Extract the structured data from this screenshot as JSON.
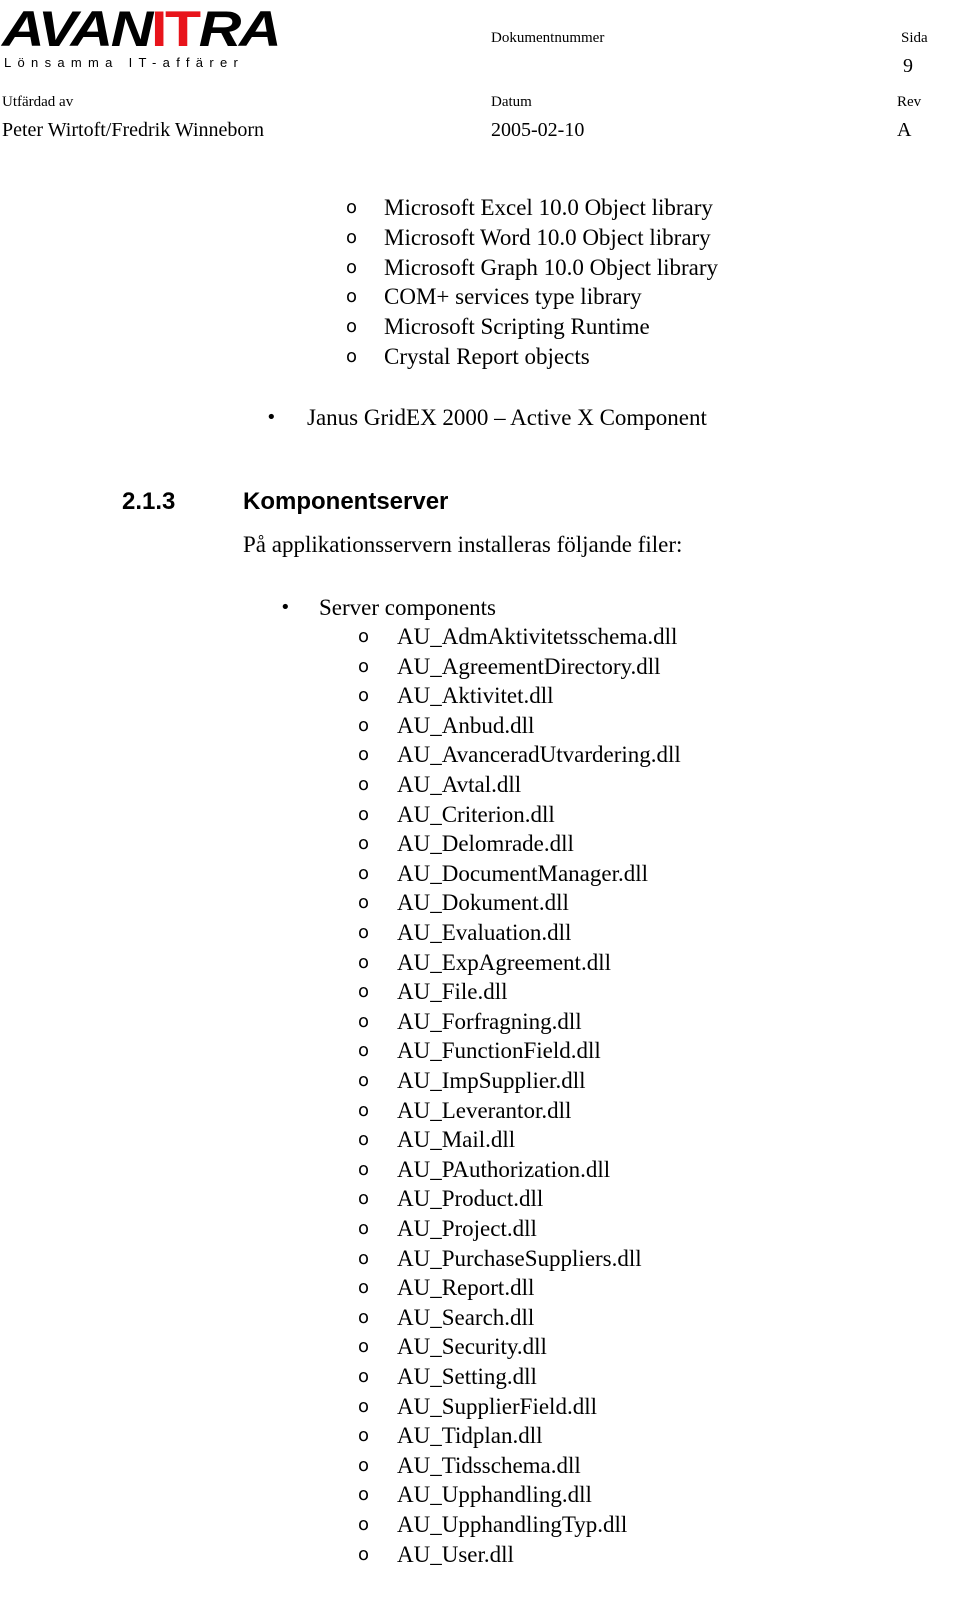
{
  "header": {
    "logo": {
      "brand_prefix": "AVAN",
      "brand_highlight": "IT",
      "brand_suffix": "RA",
      "tagline": "Lönsamma IT-affärer",
      "highlight_color": "#e8141b"
    },
    "document_number_label": "Dokumentnummer",
    "document_number_value": "",
    "page_label": "Sida",
    "page_value": "9",
    "issued_by_label": "Utfärdad av",
    "issued_by_value": "Peter Wirtoft/Fredrik Winneborn",
    "date_label": "Datum",
    "date_value": "2005-02-10",
    "rev_label": "Rev",
    "rev_value": "A"
  },
  "libraries": [
    "Microsoft Excel 10.0 Object library",
    "Microsoft  Word 10.0 Object library",
    "Microsoft  Graph 10.0 Object library",
    "COM+ services type library",
    "Microsoft Scripting Runtime",
    "Crystal Report objects"
  ],
  "component_bullet": "Janus GridEX 2000 – Active X Component",
  "section": {
    "number": "2.1.3",
    "title": "Komponentserver",
    "intro": "På applikationsservern installeras följande filer:",
    "group_label": "Server components",
    "files": [
      "AU_AdmAktivitetsschema.dll",
      "AU_AgreementDirectory.dll",
      "AU_Aktivitet.dll",
      "AU_Anbud.dll",
      "AU_AvanceradUtvardering.dll",
      "AU_Avtal.dll",
      "AU_Criterion.dll",
      "AU_Delomrade.dll",
      "AU_DocumentManager.dll",
      "AU_Dokument.dll",
      "AU_Evaluation.dll",
      "AU_ExpAgreement.dll",
      "AU_File.dll",
      "AU_Forfragning.dll",
      "AU_FunctionField.dll",
      "AU_ImpSupplier.dll",
      "AU_Leverantor.dll",
      "AU_Mail.dll",
      "AU_PAuthorization.dll",
      "AU_Product.dll",
      "AU_Project.dll",
      "AU_PurchaseSuppliers.dll",
      "AU_Report.dll",
      "AU_Search.dll",
      "AU_Security.dll",
      "AU_Setting.dll",
      "AU_SupplierField.dll",
      "AU_Tidplan.dll",
      "AU_Tidsschema.dll",
      "AU_Upphandling.dll",
      "AU_UpphandlingTyp.dll",
      "AU_User.dll"
    ]
  },
  "bullets": {
    "hollow": "o",
    "filled": "•"
  }
}
